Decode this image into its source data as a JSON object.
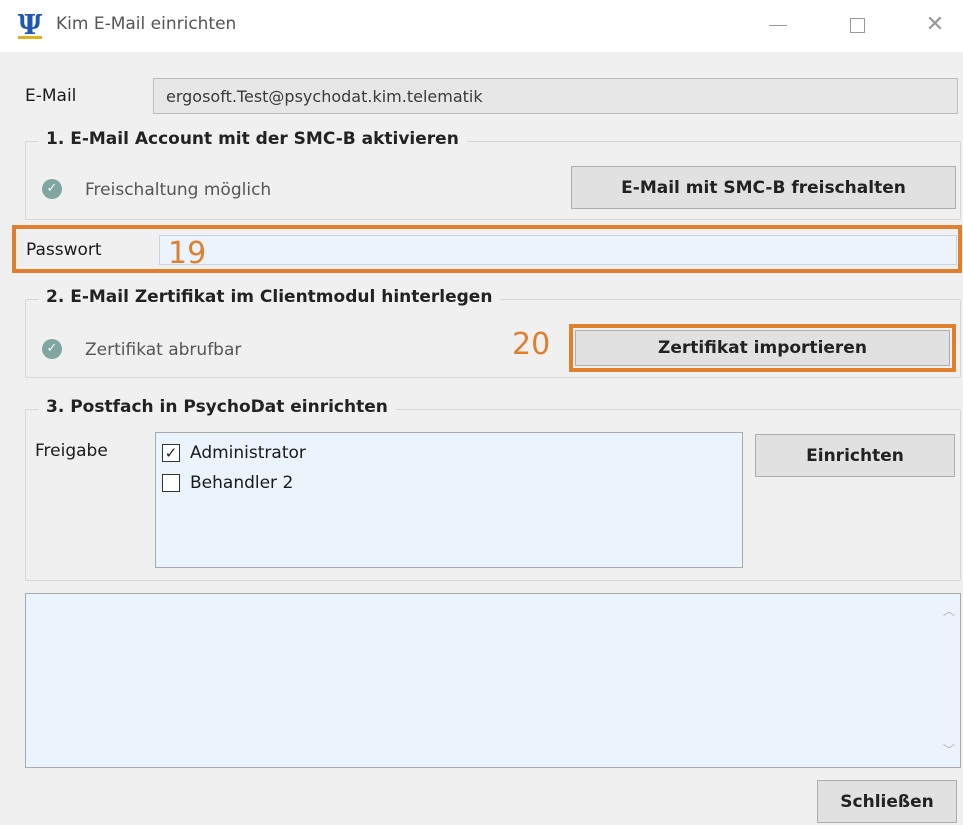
{
  "window": {
    "title": "Kim E-Mail einrichten",
    "icon_glyph": "Ψ",
    "minimize_icon": "minimize-icon",
    "maximize_icon": "maximize-icon",
    "close_icon": "close-icon",
    "close_glyph": "✕"
  },
  "email": {
    "label": "E-Mail",
    "value": "ergosoft.Test@psychodat.kim.telematik"
  },
  "section1": {
    "title": "1. E-Mail Account mit der SMC-B aktivieren",
    "status": "Freischaltung möglich",
    "button": "E-Mail mit SMC-B freischalten"
  },
  "password": {
    "label": "Passwort",
    "value": ""
  },
  "section2": {
    "title": "2. E-Mail Zertifikat im Clientmodul hinterlegen",
    "status": "Zertifikat abrufbar",
    "button": "Zertifikat importieren"
  },
  "section3": {
    "title": "3. Postfach in PsychoDat einrichten",
    "share_label": "Freigabe",
    "items": [
      {
        "label": "Administrator",
        "checked": true
      },
      {
        "label": "Behandler 2",
        "checked": false
      }
    ],
    "button": "Einrichten"
  },
  "annotations": {
    "step_19": "19",
    "step_20": "20"
  },
  "footer": {
    "close_button": "Schließen"
  },
  "colors": {
    "annotation": "#e07f2e",
    "input_bg": "#ebf3fd",
    "status_ok": "#7fa7a0",
    "app_icon": "#1f58b4"
  }
}
